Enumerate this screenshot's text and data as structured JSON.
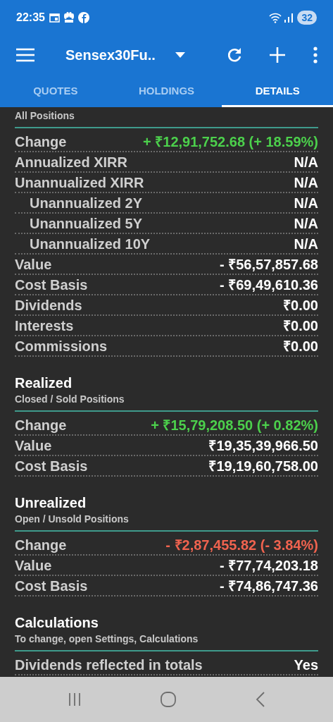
{
  "status_bar": {
    "time": "22:35",
    "battery": "32"
  },
  "toolbar": {
    "title": "Sensex30Fu.."
  },
  "tabs": [
    {
      "label": "QUOTES",
      "selected": false
    },
    {
      "label": "HOLDINGS",
      "selected": false
    },
    {
      "label": "DETAILS",
      "selected": true
    }
  ],
  "sections": [
    {
      "subtitle": "All Positions",
      "rows": [
        {
          "label": "Change",
          "value": "+ ₹12,91,752.68 (+ 18.59%)",
          "kind": "gain"
        },
        {
          "label": "Annualized XIRR",
          "value": "N/A"
        },
        {
          "label": "Unannualized XIRR",
          "value": "N/A",
          "children": [
            {
              "label": "Unannualized 2Y",
              "value": "N/A"
            },
            {
              "label": "Unannualized 5Y",
              "value": "N/A"
            },
            {
              "label": "Unannualized 10Y",
              "value": "N/A"
            }
          ]
        },
        {
          "label": "Value",
          "value": "- ₹56,57,857.68"
        },
        {
          "label": "Cost Basis",
          "value": "- ₹69,49,610.36"
        },
        {
          "label": "Dividends",
          "value": "₹0.00"
        },
        {
          "label": "Interests",
          "value": "₹0.00"
        },
        {
          "label": "Commissions",
          "value": "₹0.00"
        }
      ]
    },
    {
      "title": "Realized",
      "subtitle": "Closed / Sold Positions",
      "rows": [
        {
          "label": "Change",
          "value": "+ ₹15,79,208.50 (+ 0.82%)",
          "kind": "gain"
        },
        {
          "label": "Value",
          "value": "₹19,35,39,966.50"
        },
        {
          "label": "Cost Basis",
          "value": "₹19,19,60,758.00"
        }
      ]
    },
    {
      "title": "Unrealized",
      "subtitle": "Open / Unsold Positions",
      "rows": [
        {
          "label": "Change",
          "value": "- ₹2,87,455.82 (- 3.84%)",
          "kind": "loss"
        },
        {
          "label": "Value",
          "value": "- ₹77,74,203.18"
        },
        {
          "label": "Cost Basis",
          "value": "- ₹74,86,747.36"
        }
      ]
    },
    {
      "title": "Calculations",
      "subtitle": "To change, open Settings, Calculations",
      "rows": [
        {
          "label": "Dividends reflected in totals",
          "value": "Yes"
        }
      ]
    }
  ]
}
